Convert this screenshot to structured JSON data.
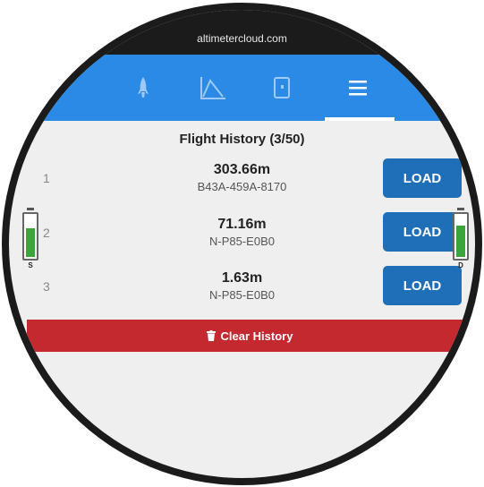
{
  "browser": {
    "url": "altimetercloud.com"
  },
  "nav": {
    "tabs": [
      {
        "name": "rocket",
        "icon": "rocket-icon",
        "active": false
      },
      {
        "name": "chart",
        "icon": "altitude-chart-icon",
        "active": false
      },
      {
        "name": "device",
        "icon": "device-icon",
        "active": false
      },
      {
        "name": "history",
        "icon": "menu-icon",
        "active": true
      }
    ]
  },
  "history": {
    "title": "Flight History (3/50)",
    "rows": [
      {
        "index": "1",
        "altitude": "303.66m",
        "device_id": "B43A-459A-8170",
        "load_label": "LOAD"
      },
      {
        "index": "2",
        "altitude": "71.16m",
        "device_id": "N-P85-E0B0",
        "load_label": "LOAD"
      },
      {
        "index": "3",
        "altitude": "1.63m",
        "device_id": "N-P85-E0B0",
        "load_label": "LOAD"
      }
    ],
    "clear_label": "Clear History"
  },
  "batteries": {
    "left": {
      "label": "S",
      "level": 0.7
    },
    "right": {
      "label": "D",
      "level": 0.75
    }
  },
  "colors": {
    "nav_bg": "#2a8ae6",
    "load_button": "#1f6fb8",
    "clear_button": "#c3292e",
    "battery_fill": "#3aa53a"
  }
}
